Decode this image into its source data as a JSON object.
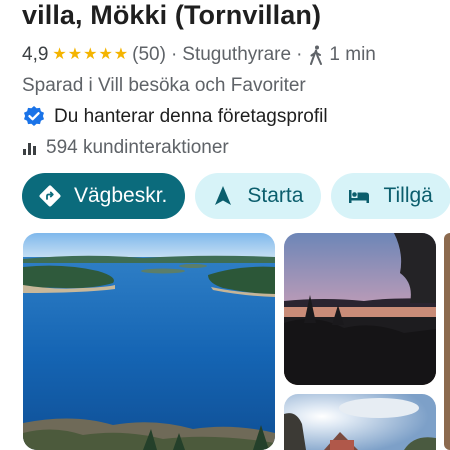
{
  "header": {
    "title": "villa, Mökki (Tornvillan)"
  },
  "rating": {
    "value": "4,9",
    "stars": 5,
    "reviews": "(50)",
    "category": "Stuguthyrare",
    "travel_time": "1 min",
    "travel_mode_icon": "walking-icon"
  },
  "saved": {
    "text": "Sparad i Vill besöka och Favoriter"
  },
  "manage": {
    "icon": "verified-icon",
    "text": "Du hanterar denna företagsprofil"
  },
  "interactions": {
    "icon": "bar-chart-icon",
    "text": "594 kundinteraktioner"
  },
  "actions": [
    {
      "label": "Vägbeskr.",
      "icon": "directions-icon"
    },
    {
      "label": "Starta",
      "icon": "navigation-arrow-icon"
    },
    {
      "label": "Tillgä",
      "icon": "bed-icon"
    }
  ],
  "colors": {
    "primary_chip": "#0b6b7c",
    "secondary_chip": "#d7f3f8",
    "secondary_chip_text": "#0b5e6d",
    "star": "#f4b400",
    "verified": "#1a73e8"
  },
  "photos": [
    {
      "name": "lake-islands-photo"
    },
    {
      "name": "sunset-lake-photo"
    },
    {
      "name": "house-sky-photo"
    }
  ]
}
